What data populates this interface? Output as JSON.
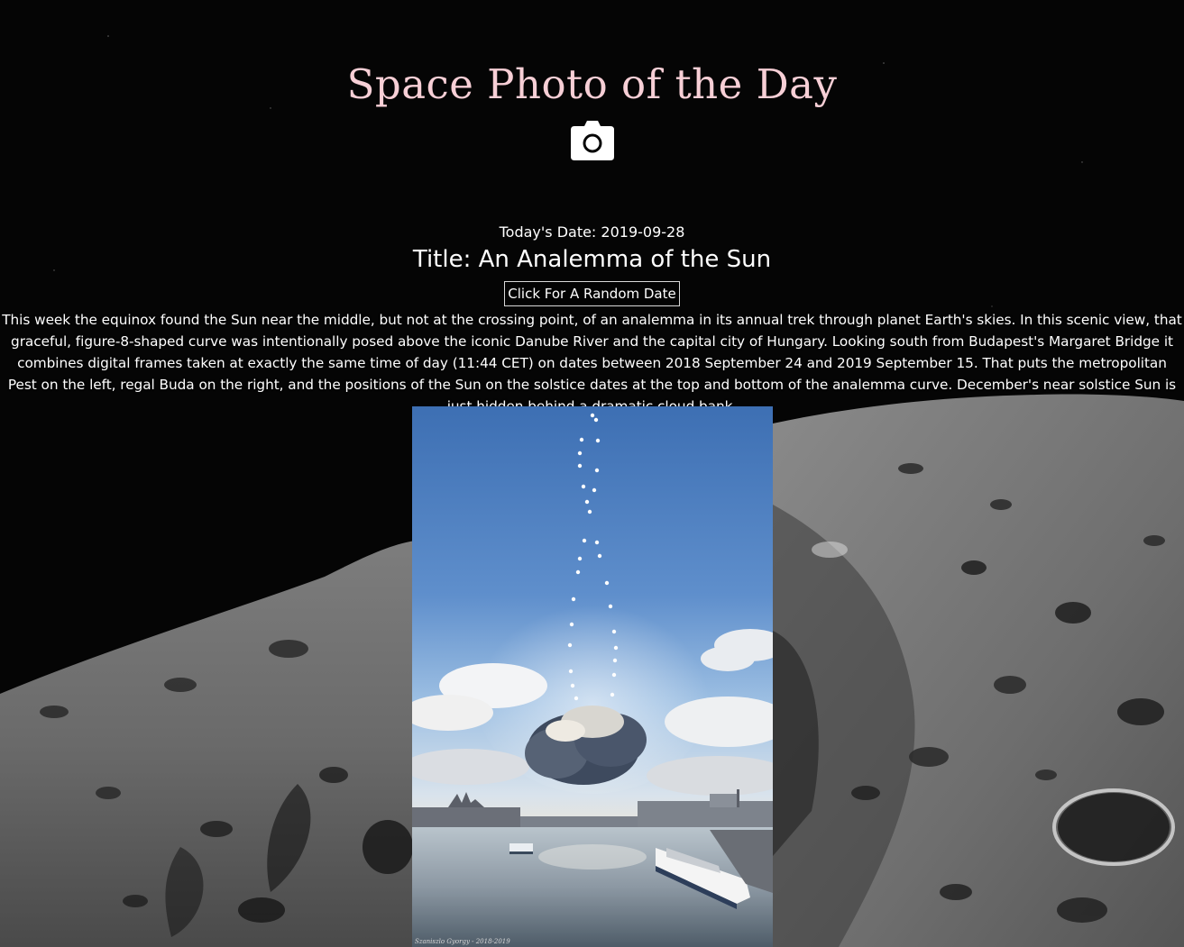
{
  "header": {
    "title": "Space Photo of the Day",
    "icon": "camera-icon"
  },
  "apod": {
    "date_label": "Today's Date: 2019-09-28",
    "title_label": "Title: An Analemma of the Sun",
    "random_button_label": "Click For A Random Date",
    "explanation": "This week the equinox found the Sun near the middle, but not at the crossing point, of an analemma in its annual trek through planet Earth's skies. In this scenic view, that graceful, figure-8-shaped curve was intentionally posed above the iconic Danube River and the capital city of Hungary. Looking south from Budapest's Margaret Bridge it combines digital frames taken at exactly the same time of day (11:44 CET) on dates between 2018 September 24 and 2019 September 15. That puts the metropolitan Pest on the left, regal Buda on the right, and the positions of the Sun on the solstice dates at the top and bottom of the analemma curve. December's near solstice Sun is just hidden behind a dramatic cloud bank.",
    "photo_credit": "Szaniszlo Gyorgy - 2018-2019"
  },
  "colors": {
    "title_pink": "#f7cfd6",
    "background": "#050505",
    "text": "#ffffff"
  }
}
